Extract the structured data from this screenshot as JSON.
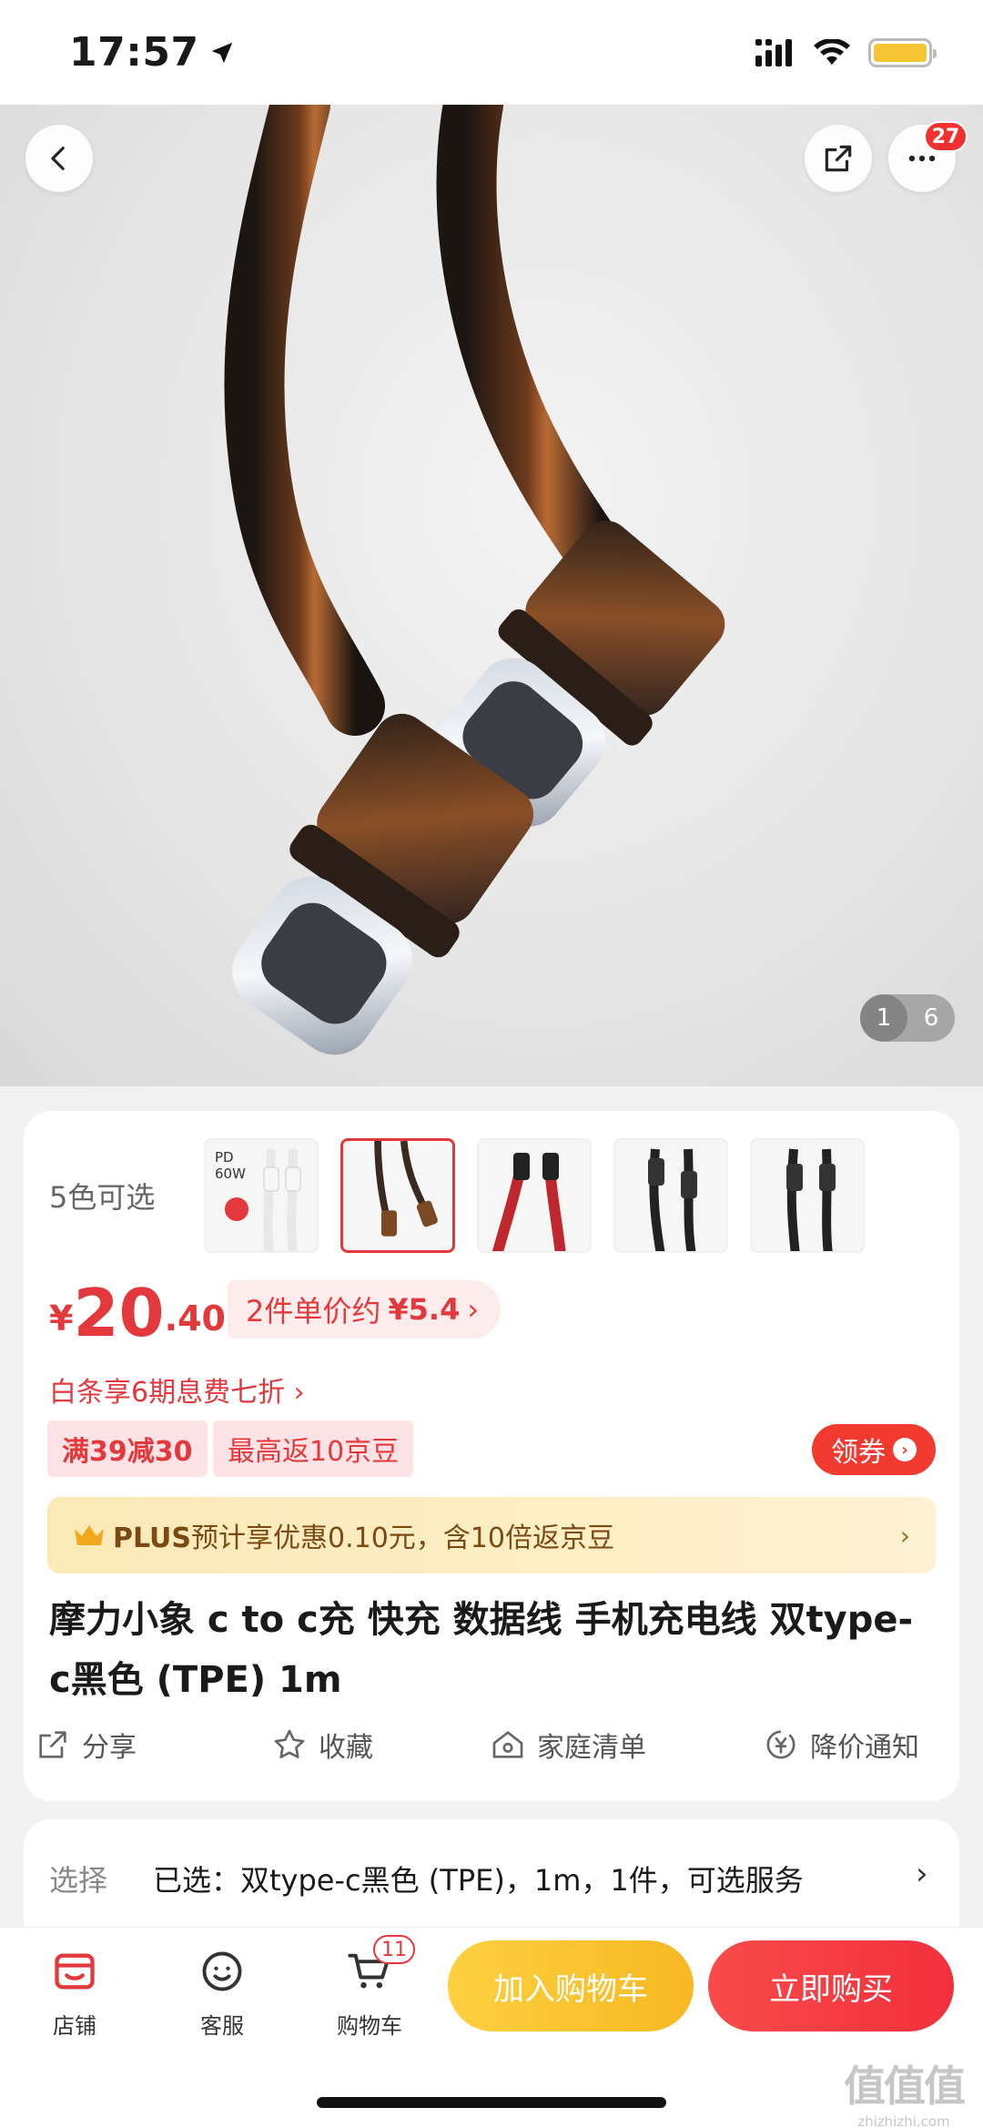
{
  "status_bar": {
    "time": "17:57"
  },
  "hero": {
    "image_index": "1",
    "image_total": "6",
    "more_badge": "27"
  },
  "colors": {
    "label": "5色可选",
    "thumbnails": [
      {
        "name": "white",
        "tag_top": "PD",
        "tag_bottom": "60W"
      },
      {
        "name": "black-tpe",
        "tag_top": "",
        "tag_bottom": ""
      },
      {
        "name": "red-braided",
        "tag_top": "",
        "tag_bottom": ""
      },
      {
        "name": "black-braided-1",
        "tag_top": "",
        "tag_bottom": ""
      },
      {
        "name": "black-braided-2",
        "tag_top": "",
        "tag_bottom": ""
      }
    ]
  },
  "price": {
    "symbol": "¥",
    "integer": "20",
    "decimal": ".40",
    "unit_tag_prefix": "2件单价约",
    "unit_tag_amount": "¥5.4",
    "unit_tag_arrow": "›"
  },
  "baitiao": "白条享6期息费七折 ›",
  "coupons": {
    "c1": "满39减30",
    "c2": "最高返10京豆",
    "get_label": "领券",
    "get_icon": "›"
  },
  "plus": {
    "strong": "PLUS",
    "text": "预计享优惠0.10元，含10倍返京豆",
    "arrow": "›"
  },
  "title": "摩力小象 c to c充 快充 数据线 手机充电线   双type-c黑色 (TPE) 1m",
  "actions": {
    "share": "分享",
    "favorite": "收藏",
    "family_list": "家庭清单",
    "price_alert": "降价通知"
  },
  "select": {
    "label": "选择",
    "value": "已选：双type-c黑色 (TPE)，1m，1件，可选服务",
    "arrow": "›"
  },
  "bottom_bar": {
    "store": "店铺",
    "service": "客服",
    "cart": "购物车",
    "cart_badge": "11",
    "add_to_cart": "加入购物车",
    "buy_now": "立即购买"
  },
  "watermark": {
    "big": "值值值",
    "small": "zhizhizhi.com"
  },
  "theme": {
    "accent": "#e4393c",
    "buy": "#f2303b",
    "cart": "#f7b824"
  }
}
